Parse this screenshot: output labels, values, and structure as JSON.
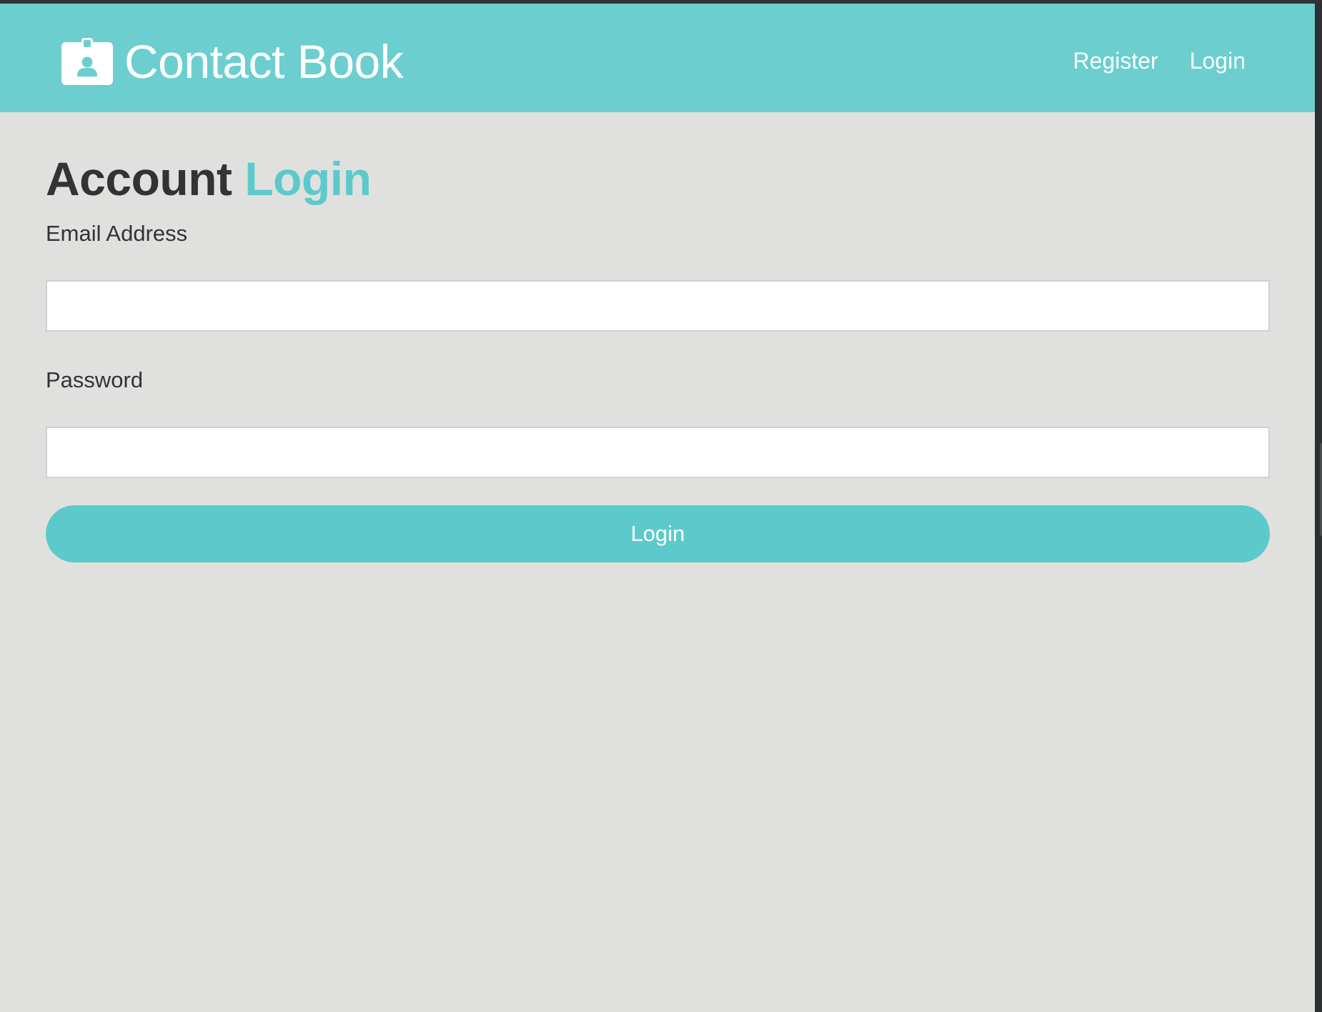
{
  "navbar": {
    "brand_title": "Contact Book",
    "brand_icon": "id-badge-icon",
    "links": {
      "register": "Register",
      "login": "Login"
    }
  },
  "form": {
    "heading_prefix": "Account",
    "heading_accent": "Login",
    "email_label": "Email Address",
    "email_value": "",
    "password_label": "Password",
    "password_value": "",
    "submit_label": "Login"
  },
  "colors": {
    "primary": "#6ccecf",
    "accent": "#5ccacb",
    "page_background": "#e0e1df",
    "text": "#333333",
    "input_background": "#ffffff"
  }
}
